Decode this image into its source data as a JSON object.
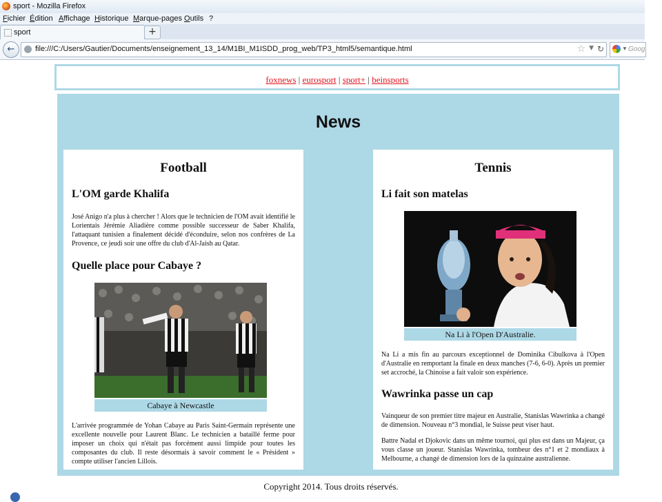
{
  "browser": {
    "title": "sport - Mozilla Firefox",
    "menu": [
      "Fichier",
      "Édition",
      "Affichage",
      "Historique",
      "Marque-pages",
      "Outils",
      "?"
    ],
    "tab_label": "sport",
    "new_tab": "+",
    "url": "file:///C:/Users/Gautier/Documents/enseignement_13_14/M1BI_M1ISDD_prog_web/TP3_html5/semantique.html",
    "search_placeholder": "Goog"
  },
  "nav": {
    "links": [
      "foxnews",
      "eurosport",
      "sport+",
      "beinsports"
    ],
    "separator": "|"
  },
  "section_title": "News",
  "football": {
    "heading": "Football",
    "article1": {
      "title": "L'OM garde Khalifa",
      "text": "José Anigo n'a plus à chercher ! Alors que le technicien de l'OM avait identifié le Lorientais Jérémie Aliadière comme possible successeur de Saber Khalifa, l'attaquant tunisien a finalement décidé d'éconduire, selon nos confrères de La Provence, ce jeudi soir une offre du club d'Al-Jaish au Qatar."
    },
    "article2": {
      "title": "Quelle place pour Cabaye ?",
      "caption": "Cabaye à Newcastle",
      "text": "L'arrivée programmée de Yohan Cabaye au Paris Saint-Germain représente une excellente nouvelle pour Laurent Blanc. Le technicien a bataillé ferme pour imposer un choix qui n'était pas forcément aussi limpide pour toutes les composantes du club. Il reste désormais à savoir comment le « Président » compte utiliser l'ancien Lillois."
    }
  },
  "tennis": {
    "heading": "Tennis",
    "article1": {
      "title": "Li fait son matelas",
      "caption": "Na Li à l'Open D'Australie.",
      "text": "Na Li a mis fin au parcours exceptionnel de Dominika Cibulkova à l'Open d'Australie en remportant la finale en deux manches (7-6, 6-0). Après un premier set accroché, la Chinoise a fait valoir son expérience."
    },
    "article2": {
      "title": "Wawrinka passe un cap",
      "text1": "Vainqueur de son premier titre majeur en Australie, Stanislas Wawrinka a changé de dimension. Nouveau n°3 mondial, le Suisse peut viser haut.",
      "text2": "Battre Nadal et Djokovic dans un même tournoi, qui plus est dans un Majeur, ça vous classe un joueur. Stanislas Wawrinka, tombeur des n°1 et 2 mondiaux à Melbourne, a changé de dimension lors de la quinzaine australienne."
    }
  },
  "footer": "Copyright 2014. Tous droits réservés.",
  "colors": {
    "panel": "#add8e6",
    "link": "#e0141e"
  }
}
